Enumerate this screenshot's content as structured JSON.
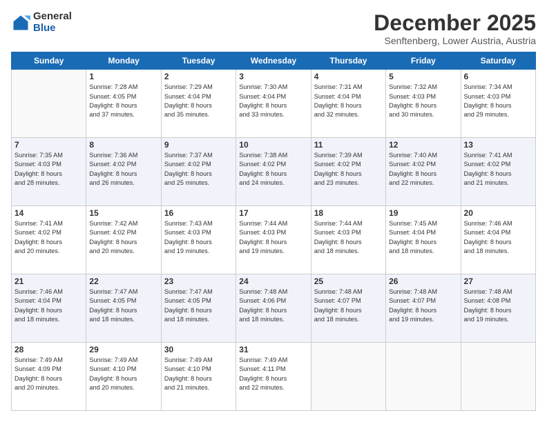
{
  "logo": {
    "general": "General",
    "blue": "Blue"
  },
  "header": {
    "month": "December 2025",
    "location": "Senftenberg, Lower Austria, Austria"
  },
  "weekdays": [
    "Sunday",
    "Monday",
    "Tuesday",
    "Wednesday",
    "Thursday",
    "Friday",
    "Saturday"
  ],
  "weeks": [
    [
      {
        "day": "",
        "info": ""
      },
      {
        "day": "1",
        "info": "Sunrise: 7:28 AM\nSunset: 4:05 PM\nDaylight: 8 hours\nand 37 minutes."
      },
      {
        "day": "2",
        "info": "Sunrise: 7:29 AM\nSunset: 4:04 PM\nDaylight: 8 hours\nand 35 minutes."
      },
      {
        "day": "3",
        "info": "Sunrise: 7:30 AM\nSunset: 4:04 PM\nDaylight: 8 hours\nand 33 minutes."
      },
      {
        "day": "4",
        "info": "Sunrise: 7:31 AM\nSunset: 4:04 PM\nDaylight: 8 hours\nand 32 minutes."
      },
      {
        "day": "5",
        "info": "Sunrise: 7:32 AM\nSunset: 4:03 PM\nDaylight: 8 hours\nand 30 minutes."
      },
      {
        "day": "6",
        "info": "Sunrise: 7:34 AM\nSunset: 4:03 PM\nDaylight: 8 hours\nand 29 minutes."
      }
    ],
    [
      {
        "day": "7",
        "info": "Sunrise: 7:35 AM\nSunset: 4:03 PM\nDaylight: 8 hours\nand 28 minutes."
      },
      {
        "day": "8",
        "info": "Sunrise: 7:36 AM\nSunset: 4:02 PM\nDaylight: 8 hours\nand 26 minutes."
      },
      {
        "day": "9",
        "info": "Sunrise: 7:37 AM\nSunset: 4:02 PM\nDaylight: 8 hours\nand 25 minutes."
      },
      {
        "day": "10",
        "info": "Sunrise: 7:38 AM\nSunset: 4:02 PM\nDaylight: 8 hours\nand 24 minutes."
      },
      {
        "day": "11",
        "info": "Sunrise: 7:39 AM\nSunset: 4:02 PM\nDaylight: 8 hours\nand 23 minutes."
      },
      {
        "day": "12",
        "info": "Sunrise: 7:40 AM\nSunset: 4:02 PM\nDaylight: 8 hours\nand 22 minutes."
      },
      {
        "day": "13",
        "info": "Sunrise: 7:41 AM\nSunset: 4:02 PM\nDaylight: 8 hours\nand 21 minutes."
      }
    ],
    [
      {
        "day": "14",
        "info": "Sunrise: 7:41 AM\nSunset: 4:02 PM\nDaylight: 8 hours\nand 20 minutes."
      },
      {
        "day": "15",
        "info": "Sunrise: 7:42 AM\nSunset: 4:02 PM\nDaylight: 8 hours\nand 20 minutes."
      },
      {
        "day": "16",
        "info": "Sunrise: 7:43 AM\nSunset: 4:03 PM\nDaylight: 8 hours\nand 19 minutes."
      },
      {
        "day": "17",
        "info": "Sunrise: 7:44 AM\nSunset: 4:03 PM\nDaylight: 8 hours\nand 19 minutes."
      },
      {
        "day": "18",
        "info": "Sunrise: 7:44 AM\nSunset: 4:03 PM\nDaylight: 8 hours\nand 18 minutes."
      },
      {
        "day": "19",
        "info": "Sunrise: 7:45 AM\nSunset: 4:04 PM\nDaylight: 8 hours\nand 18 minutes."
      },
      {
        "day": "20",
        "info": "Sunrise: 7:46 AM\nSunset: 4:04 PM\nDaylight: 8 hours\nand 18 minutes."
      }
    ],
    [
      {
        "day": "21",
        "info": "Sunrise: 7:46 AM\nSunset: 4:04 PM\nDaylight: 8 hours\nand 18 minutes."
      },
      {
        "day": "22",
        "info": "Sunrise: 7:47 AM\nSunset: 4:05 PM\nDaylight: 8 hours\nand 18 minutes."
      },
      {
        "day": "23",
        "info": "Sunrise: 7:47 AM\nSunset: 4:05 PM\nDaylight: 8 hours\nand 18 minutes."
      },
      {
        "day": "24",
        "info": "Sunrise: 7:48 AM\nSunset: 4:06 PM\nDaylight: 8 hours\nand 18 minutes."
      },
      {
        "day": "25",
        "info": "Sunrise: 7:48 AM\nSunset: 4:07 PM\nDaylight: 8 hours\nand 18 minutes."
      },
      {
        "day": "26",
        "info": "Sunrise: 7:48 AM\nSunset: 4:07 PM\nDaylight: 8 hours\nand 19 minutes."
      },
      {
        "day": "27",
        "info": "Sunrise: 7:48 AM\nSunset: 4:08 PM\nDaylight: 8 hours\nand 19 minutes."
      }
    ],
    [
      {
        "day": "28",
        "info": "Sunrise: 7:49 AM\nSunset: 4:09 PM\nDaylight: 8 hours\nand 20 minutes."
      },
      {
        "day": "29",
        "info": "Sunrise: 7:49 AM\nSunset: 4:10 PM\nDaylight: 8 hours\nand 20 minutes."
      },
      {
        "day": "30",
        "info": "Sunrise: 7:49 AM\nSunset: 4:10 PM\nDaylight: 8 hours\nand 21 minutes."
      },
      {
        "day": "31",
        "info": "Sunrise: 7:49 AM\nSunset: 4:11 PM\nDaylight: 8 hours\nand 22 minutes."
      },
      {
        "day": "",
        "info": ""
      },
      {
        "day": "",
        "info": ""
      },
      {
        "day": "",
        "info": ""
      }
    ]
  ]
}
